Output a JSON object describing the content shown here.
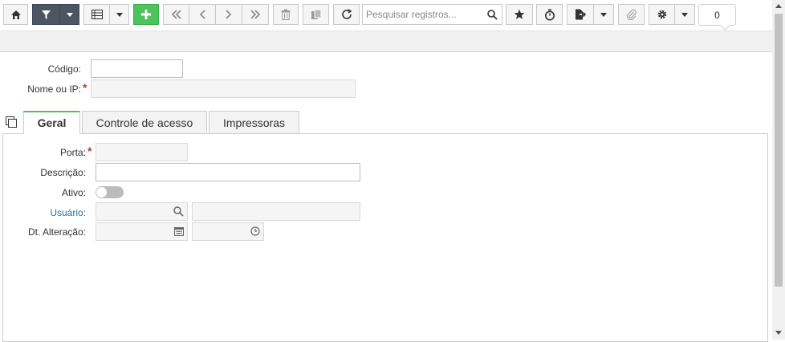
{
  "toolbar": {
    "search_placeholder": "Pesquisar registros...",
    "record_count": "0"
  },
  "form": {
    "codigo_label": "Código:",
    "nome_label": "Nome ou IP:",
    "codigo_value": "",
    "nome_value": ""
  },
  "tabs": [
    {
      "label": "Geral"
    },
    {
      "label": "Controle de acesso"
    },
    {
      "label": "Impressoras"
    }
  ],
  "geral": {
    "porta_label": "Porta:",
    "descricao_label": "Descrição:",
    "ativo_label": "Ativo:",
    "usuario_label": "Usuário:",
    "dt_alteracao_label": "Dt. Alteração:",
    "ativo_on": false
  },
  "colors": {
    "primary_dark": "#4d5562",
    "add_green": "#4cc45b",
    "link_blue": "#1f6fb2",
    "required_red": "#c0392b"
  },
  "icons": [
    "home-icon",
    "filter-icon",
    "grid-icon",
    "plus-icon",
    "first-page-icon",
    "prev-page-icon",
    "next-page-icon",
    "last-page-icon",
    "trash-icon",
    "copy-icon",
    "refresh-icon",
    "search-icon",
    "star-icon",
    "stopwatch-icon",
    "export-file-icon",
    "paperclip-icon",
    "gear-icon",
    "calendar-icon",
    "clock-icon",
    "tabs-toggle-icon"
  ]
}
